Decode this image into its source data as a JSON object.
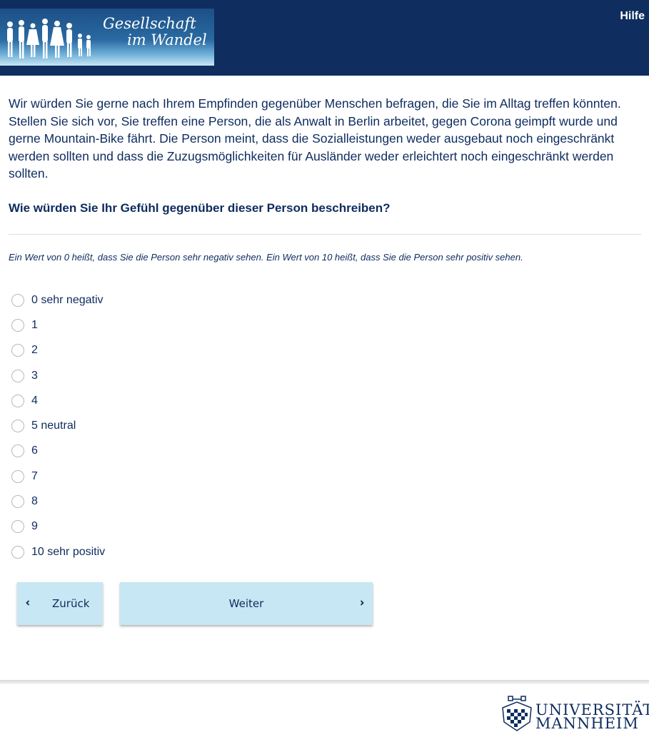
{
  "header": {
    "logo_line1": "Gesellschaft",
    "logo_line2": "im Wandel",
    "help_label": "Hilfe",
    "bg_color": "#0f2d5f"
  },
  "question": {
    "intro": "Wir würden Sie gerne nach Ihrem Empfinden gegenüber Menschen befragen, die Sie im Alltag treffen könnten. Stellen Sie sich vor, Sie treffen eine Person, die als Anwalt in Berlin arbeitet, gegen Corona geimpft wurde und gerne Mountain-Bike fährt. Die Person meint, dass die Sozialleistungen weder ausgebaut noch eingeschränkt werden sollten und dass die Zuzugsmöglichkeiten für Ausländer weder erleichtert noch eingeschränkt werden sollten.",
    "title": "Wie würden Sie Ihr Gefühl gegenüber dieser Person beschreiben?",
    "hint": "Ein Wert von 0 heißt, dass Sie die Person sehr negativ sehen. Ein Wert von 10 heißt, dass Sie die Person sehr positiv sehen."
  },
  "options": [
    "0 sehr negativ",
    "1",
    "2",
    "3",
    "4",
    "5 neutral",
    "6",
    "7",
    "8",
    "9",
    "10 sehr positiv"
  ],
  "navigation": {
    "back_label": "Zurück",
    "next_label": "Weiter",
    "button_color": "#c8e7f4"
  },
  "footer": {
    "logo_line1": "UNIVERSITÄT",
    "logo_line2": "MANNHEIM"
  }
}
